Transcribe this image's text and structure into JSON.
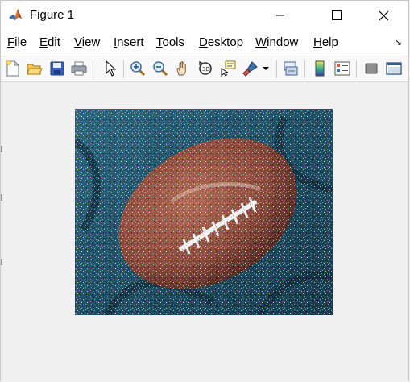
{
  "window": {
    "title": "Figure 1"
  },
  "menu": {
    "items": [
      {
        "label": "File",
        "mnemonic": "F"
      },
      {
        "label": "Edit",
        "mnemonic": "E"
      },
      {
        "label": "View",
        "mnemonic": "V"
      },
      {
        "label": "Insert",
        "mnemonic": "I"
      },
      {
        "label": "Tools",
        "mnemonic": "T"
      },
      {
        "label": "Desktop",
        "mnemonic": "D"
      },
      {
        "label": "Window",
        "mnemonic": "W"
      },
      {
        "label": "Help",
        "mnemonic": "H"
      }
    ]
  },
  "toolbar": {
    "buttons": [
      "new-figure-icon",
      "open-file-icon",
      "save-icon",
      "print-icon",
      "edit-plot-arrow-icon",
      "zoom-in-icon",
      "zoom-out-icon",
      "pan-hand-icon",
      "rotate-3d-icon",
      "data-cursor-icon",
      "brush-icon",
      "brush-dropdown-icon",
      "link-plot-icon",
      "insert-colorbar-icon",
      "insert-legend-icon",
      "hide-plot-tools-icon",
      "show-plot-tools-icon"
    ]
  },
  "figure": {
    "image_description_icon": "noisy-football-image",
    "colors": {
      "background": "#f0f0f0",
      "titlebar": "#ffffff",
      "ball": "#8a4a3c",
      "cloth": "#1f4f66"
    }
  }
}
